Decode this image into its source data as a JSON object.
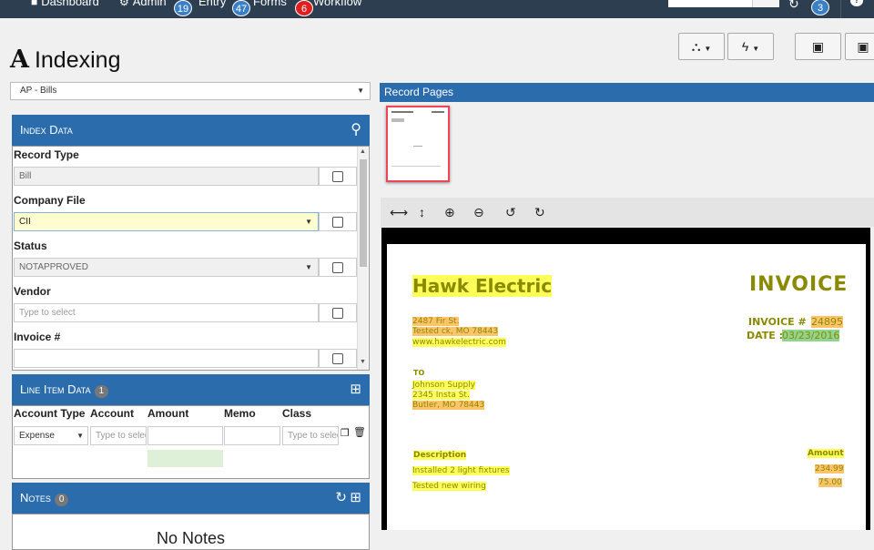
{
  "topnav": {
    "items": [
      "Dashboard",
      "Admin",
      "Entry",
      "Forms",
      "Workflow"
    ],
    "badges": {
      "entry": "19",
      "forms": "47",
      "workflow": "6",
      "alerts": "3"
    }
  },
  "page": {
    "title": "Indexing",
    "logo": "A"
  },
  "template_select": "AP - Bills",
  "index_data": {
    "header": "Index Data",
    "fields": [
      {
        "label": "Record Type",
        "value": "Bill"
      },
      {
        "label": "Company File",
        "value": "CII"
      },
      {
        "label": "Status",
        "value": "NOTAPPROVED"
      },
      {
        "label": "Vendor",
        "placeholder": "Type to select"
      },
      {
        "label": "Invoice #",
        "value": ""
      }
    ]
  },
  "line_items": {
    "header": "Line Item Data",
    "count": "1",
    "columns": [
      "Account Type",
      "Account",
      "Amount",
      "Memo",
      "Class"
    ],
    "row": {
      "account_type": "Expense",
      "account_placeholder": "Type to select",
      "class_placeholder": "Type to select"
    }
  },
  "notes": {
    "header": "Notes",
    "count": "0",
    "empty_text": "No Notes"
  },
  "record_pages": {
    "header": "Record Pages"
  },
  "invoice": {
    "company": "Hawk Electric",
    "title": "INVOICE",
    "address": [
      "2487 Fir St.",
      "Tested ck, MO 78443",
      "www.hawkelectric.com"
    ],
    "invoice_no_label": "INVOICE #",
    "invoice_no": "24895",
    "date_label": "DATE :",
    "date": "03/23/2016",
    "to_label": "TO",
    "to": [
      "Johnson Supply",
      "2345 Insta St.",
      "Butler, MO 78443"
    ],
    "desc_label": "Description",
    "amount_label": "Amount",
    "lines": [
      {
        "desc": "Installed 2 light fixtures",
        "amount": "234.99"
      },
      {
        "desc": "Tested new wiring",
        "amount": "75.00"
      }
    ]
  },
  "colors": {
    "nav": "#2d3e50",
    "panel_header": "#2b6cad",
    "highlight_yellow": "#ffff5a",
    "highlight_orange": "#ffc46a",
    "highlight_green": "#8fd58f"
  }
}
